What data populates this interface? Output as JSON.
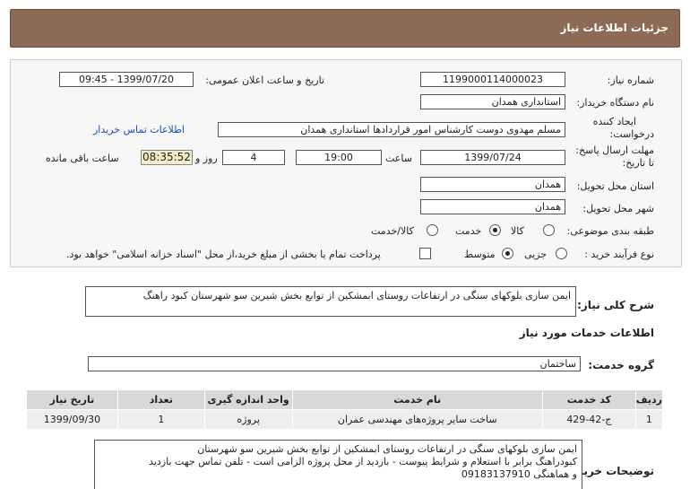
{
  "header": {
    "title": "جزئیات اطلاعات نیاز"
  },
  "fields": {
    "need_number_label": "شماره نیاز:",
    "need_number": "1199000114000023",
    "announce_label": "تاریخ و ساعت اعلان عمومی:",
    "announce_value": "1399/07/20 - 09:45",
    "buyer_org_label": "نام دستگاه خریدار:",
    "buyer_org": "استانداری همدان",
    "requester_label_1": "ایجاد کننده",
    "requester_label_2": "درخواست:",
    "requester": "مسلم مهدوی دوست کارشناس امور قراردادها استانداری همدان",
    "contact_link": "اطلاعات تماس خریدار",
    "deadline_label_1": "مهلت ارسال پاسخ:",
    "deadline_label_2": "تا تاریخ:",
    "deadline_date": "1399/07/24",
    "time_label": "ساعت",
    "deadline_time": "19:00",
    "days_value": "4",
    "days_label": "روز و",
    "remaining_time": "08:35:52",
    "remaining_label": "ساعت باقی مانده",
    "province_label": "استان محل تحویل:",
    "province": "همدان",
    "city_label": "شهر محل تحویل:",
    "city": "همدان",
    "category_label": "طبقه بندی موضوعی:",
    "category_options": [
      "کالا",
      "خدمت",
      "کالا/خدمت"
    ],
    "category_selected": "خدمت",
    "process_label": "نوع فرآیند خرید :",
    "process_options": [
      "جزیی",
      "متوسط"
    ],
    "process_selected": "متوسط",
    "payment_note": "پرداخت تمام یا بخشی از مبلغ خرید،از محل \"اسناد خزانه اسلامی\" خواهد بود."
  },
  "summary": {
    "label": "شرح کلی نیاز:",
    "text": "ایمن سازی بلوکهای سنگی در ارتفاعات روستای ابمشکین از توابع بخش شیرین سو شهرستان کبود راهنگ"
  },
  "services": {
    "section_title": "اطلاعات خدمات مورد نیاز",
    "group_label": "گروه خدمت:",
    "group_value": "ساختمان",
    "columns": [
      "ردیف",
      "کد خدمت",
      "نام خدمت",
      "واحد اندازه گیری",
      "تعداد",
      "تاریخ نیاز"
    ],
    "rows": [
      [
        "1",
        "ج-42-429",
        "ساخت سایر پروژه‌های مهندسی عمران",
        "پروژه",
        "1",
        "1399/09/30"
      ]
    ]
  },
  "buyer_notes": {
    "label": "توضیحات خریدار:",
    "line1": "ایمن سازی بلوکهای سنگی در ارتفاعات روستای ابمشکین از توابع بخش شیرین سو شهرستان",
    "line2": "کبودراهنگ برابر با استعلام و شرایط پیوست - بازدید از محل پروژه الزامی است - تلفن تماس جهت بازدید",
    "line3": "و هماهنگی  09183137910"
  }
}
